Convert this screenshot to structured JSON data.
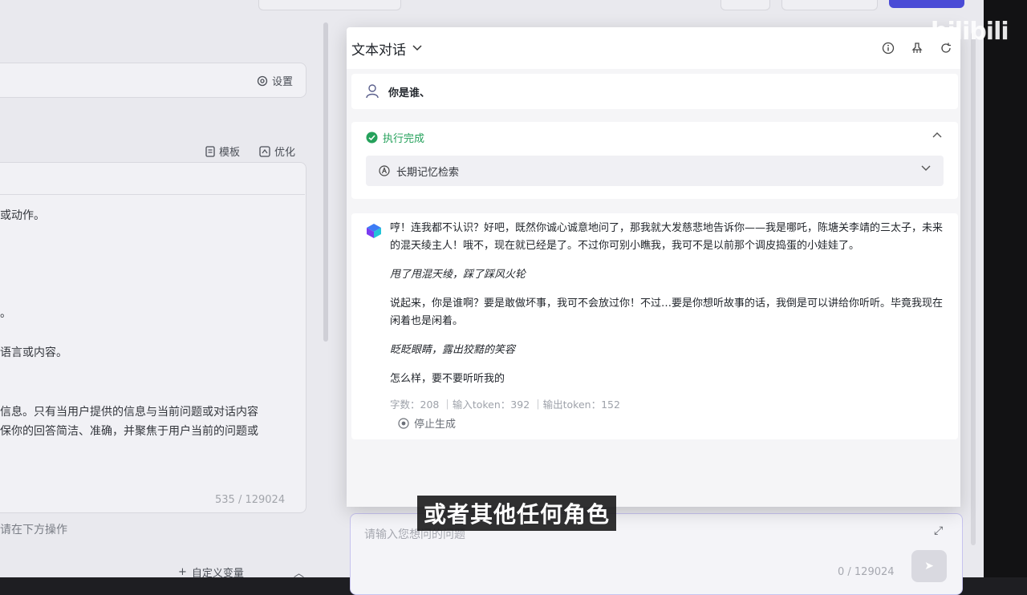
{
  "background": {
    "settings_label": "设置",
    "toolbar": {
      "template_label": "模板",
      "optimize_label": "优化"
    },
    "editor_lines": [
      "或动作。",
      "。",
      "语言或内容。",
      "信息。只有当用户提供的信息与当前问题或对话内容",
      "保你的回答简洁、准确，并聚焦于用户当前的问题或"
    ],
    "editor_count": "535 / 129024",
    "hint": "请在下方操作",
    "custom_variable_label": "自定义变量",
    "input_placeholder": "请输入您想问的问题",
    "input_count": "0 / 129024"
  },
  "dialog": {
    "title": "文本对话",
    "user_message": "你是谁、",
    "execution_status": "执行完成",
    "memory_step": "长期记忆检索",
    "reply": {
      "paragraph1": "哼！连我都不认识？好吧，既然你诚心诚意地问了，那我就大发慈悲地告诉你——我是哪吒，陈塘关李靖的三太子，未来的混天绫主人！哦不，现在就已经是了。不过你可别小瞧我，我可不是以前那个调皮捣蛋的小娃娃了。",
      "action1": "甩了甩混天绫，踩了踩风火轮",
      "paragraph2": "说起来，你是谁啊？要是敢做坏事，我可不会放过你！不过…要是你想听故事的话，我倒是可以讲给你听听。毕竟我现在闲着也是闲着。",
      "action2": "眨眨眼睛，露出狡黠的笑容",
      "paragraph3": "怎么样，要不要听听我的"
    },
    "meta": "字数：208 ｜输入token：392 ｜输出token：152",
    "stop_label": "停止生成"
  },
  "watermark": "bilibili",
  "subtitle": "或者其他任何角色",
  "colors": {
    "accent": "#4a4bd6",
    "success": "#25a15b",
    "bot_icon_top": "#3d7cf5",
    "bot_icon_bottom": "#7a3cf0"
  }
}
